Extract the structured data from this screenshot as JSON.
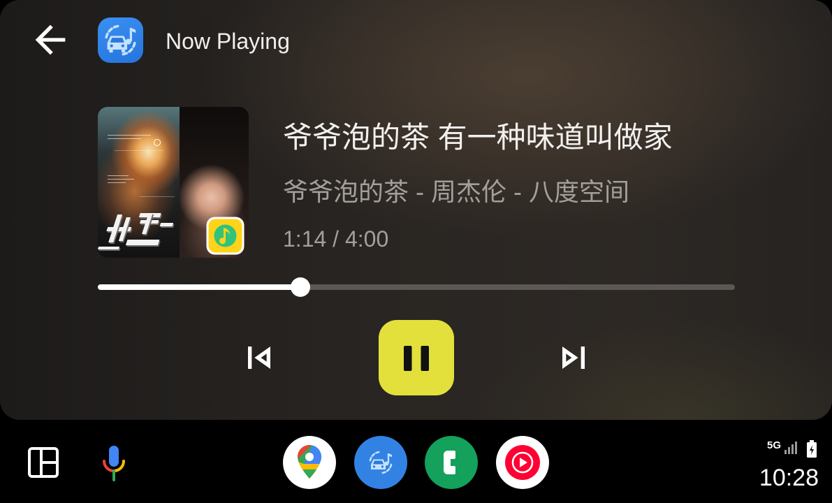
{
  "header": {
    "back_icon": "arrow-back-icon",
    "app_icon": "car-media-app-icon",
    "title": "Now Playing"
  },
  "now_playing": {
    "album_art_badge_icon": "qq-music-icon",
    "title": "爷爷泡的茶 有一种味道叫做家",
    "subtitle": "爷爷泡的茶 - 周杰伦 - 八度空间",
    "position_text": "1:14 / 4:00",
    "progress": 0.318
  },
  "controls": {
    "previous_icon": "skip-previous-icon",
    "play_pause_icon": "pause-icon",
    "next_icon": "skip-next-icon"
  },
  "dock": {
    "dashboard_icon": "dashboard-layout-icon",
    "mic_icon": "google-assistant-mic-icon",
    "apps": [
      {
        "icon": "google-maps-icon"
      },
      {
        "icon": "car-media-app-icon"
      },
      {
        "icon": "phone-icon"
      },
      {
        "icon": "youtube-music-icon"
      }
    ]
  },
  "status_bar": {
    "network": "5G",
    "signal_icon": "cell-signal-icon",
    "battery_icon": "battery-charging-icon",
    "clock": "10:28"
  },
  "colors": {
    "accent": "#e3e03c",
    "primary_text": "#f2f0ee",
    "secondary_text": "#a39f9b",
    "progress_fill": "#ffffff",
    "progress_track": "#5b5754",
    "app_blue": "#3282e4",
    "phone_green": "#13a15b",
    "youtube_red": "#ff0033"
  }
}
